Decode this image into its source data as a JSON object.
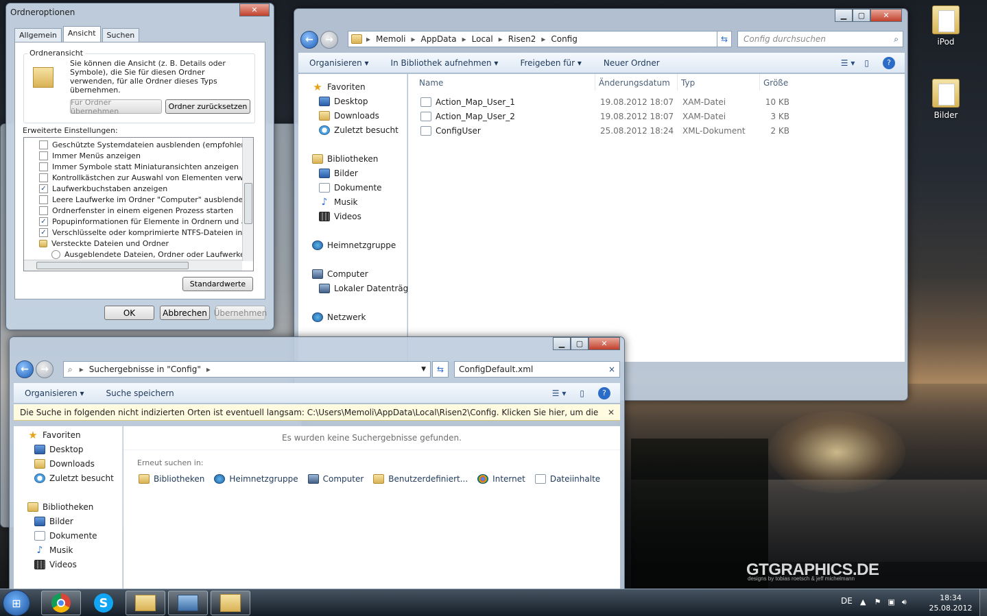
{
  "desktop": {
    "icons": [
      {
        "label": "iPod"
      },
      {
        "label": "Bilder"
      }
    ],
    "watermark": "GTGRAPHICS.DE",
    "watermark_sub": "designs by tobias roetsch & jeff michelmann"
  },
  "explorer": {
    "breadcrumb": [
      "Memoli",
      "AppData",
      "Local",
      "Risen2",
      "Config"
    ],
    "search_placeholder": "Config durchsuchen",
    "toolbar": [
      "Organisieren ▾",
      "In Bibliothek aufnehmen ▾",
      "Freigeben für ▾",
      "Neuer Ordner"
    ],
    "nav": {
      "favorites": "Favoriten",
      "fav_items": [
        "Desktop",
        "Downloads",
        "Zuletzt besucht"
      ],
      "libraries": "Bibliotheken",
      "lib_items": [
        "Bilder",
        "Dokumente",
        "Musik",
        "Videos"
      ],
      "homegroup": "Heimnetzgruppe",
      "computer": "Computer",
      "computer_items": [
        "Lokaler Datenträger"
      ],
      "network": "Netzwerk"
    },
    "columns": [
      "Name",
      "Änderungsdatum",
      "Typ",
      "Größe"
    ],
    "files": [
      {
        "name": "Action_Map_User_1",
        "date": "19.08.2012 18:07",
        "type": "XAM-Datei",
        "size": "10 KB"
      },
      {
        "name": "Action_Map_User_2",
        "date": "19.08.2012 18:07",
        "type": "XAM-Datei",
        "size": "3 KB"
      },
      {
        "name": "ConfigUser",
        "date": "25.08.2012 18:24",
        "type": "XML-Dokument",
        "size": "2 KB"
      }
    ]
  },
  "search_window": {
    "address": "Suchergebnisse in \"Config\"",
    "search_value": "ConfigDefault.xml",
    "toolbar": [
      "Organisieren ▾",
      "Suche speichern"
    ],
    "info_bar": "Die Suche in folgenden nicht indizierten Orten ist eventuell langsam: C:\\Users\\Memoli\\AppData\\Local\\Risen2\\Config. Klicken Sie hier, um die Orte zum Index ...",
    "no_results": "Es wurden keine Suchergebnisse gefunden.",
    "search_again_label": "Erneut suchen in:",
    "search_again": [
      "Bibliotheken",
      "Heimnetzgruppe",
      "Computer",
      "Benutzerdefiniert...",
      "Internet",
      "Dateiinhalte"
    ],
    "nav": {
      "favorites": "Favoriten",
      "fav_items": [
        "Desktop",
        "Downloads",
        "Zuletzt besucht"
      ],
      "libraries": "Bibliotheken",
      "lib_items": [
        "Bilder",
        "Dokumente",
        "Musik",
        "Videos"
      ]
    }
  },
  "folder_options": {
    "title": "Ordneroptionen",
    "tabs": [
      "Allgemein",
      "Ansicht",
      "Suchen"
    ],
    "group_title": "Ordneransicht",
    "group_text": "Sie können die Ansicht (z. B. Details oder Symbole), die Sie für diesen Ordner verwenden, für alle Ordner dieses Typs übernehmen.",
    "apply_folders": "Für Ordner übernehmen",
    "reset_folders": "Ordner zurücksetzen",
    "advanced_label": "Erweiterte Einstellungen:",
    "settings": [
      {
        "label": "Geschützte Systemdateien ausblenden (empfohlen)",
        "checked": false
      },
      {
        "label": "Immer Menüs anzeigen",
        "checked": false
      },
      {
        "label": "Immer Symbole statt Miniaturansichten anzeigen",
        "checked": false
      },
      {
        "label": "Kontrollkästchen zur Auswahl von Elementen verwenden",
        "checked": false
      },
      {
        "label": "Laufwerkbuchstaben anzeigen",
        "checked": true
      },
      {
        "label": "Leere Laufwerke im Ordner \"Computer\" ausblenden",
        "checked": false
      },
      {
        "label": "Ordnerfenster in einem eigenen Prozess starten",
        "checked": false
      },
      {
        "label": "Popupinformationen für Elemente in Ordnern und auf dem D",
        "checked": true
      },
      {
        "label": "Verschlüsselte oder komprimierte NTFS-Dateien in anderer",
        "checked": true
      }
    ],
    "hidden_folder": "Versteckte Dateien und Ordner",
    "hidden_option": "Ausgeblendete Dateien, Ordner oder Laufwerke nicht a",
    "defaults": "Standardwerte",
    "ok": "OK",
    "cancel": "Abbrechen",
    "apply": "Übernehmen"
  },
  "taskbar": {
    "lang": "DE",
    "time": "18:34",
    "date": "25.08.2012"
  }
}
